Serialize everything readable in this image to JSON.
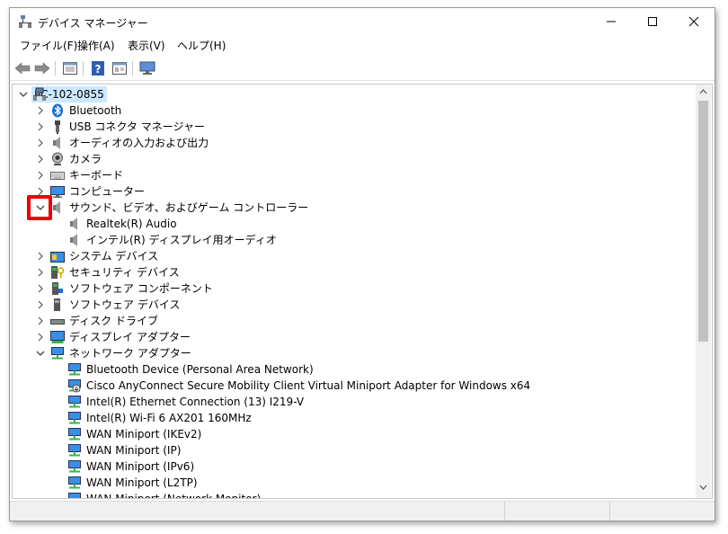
{
  "window": {
    "title": "デバイス マネージャー"
  },
  "menu": {
    "items": [
      "ファイル(F)",
      "操作(A)",
      "表示(V)",
      "ヘルプ(H)"
    ]
  },
  "toolbar": {
    "buttons": [
      "back-arrow-icon",
      "forward-arrow-icon",
      "properties-icon",
      "help-icon",
      "view-icon",
      "monitor-scan-icon"
    ]
  },
  "tree": {
    "root": "PC-102-0855",
    "nodes": [
      {
        "label": "Bluetooth",
        "icon": "bluetooth-icon",
        "state": "collapsed"
      },
      {
        "label": "USB コネクタ マネージャー",
        "icon": "usb-connector-icon",
        "state": "collapsed"
      },
      {
        "label": "オーディオの入力および出力",
        "icon": "speaker-icon",
        "state": "collapsed"
      },
      {
        "label": "カメラ",
        "icon": "camera-icon",
        "state": "collapsed"
      },
      {
        "label": "キーボード",
        "icon": "keyboard-icon",
        "state": "collapsed"
      },
      {
        "label": "コンピューター",
        "icon": "computer-icon",
        "state": "collapsed"
      },
      {
        "label": "サウンド、ビデオ、およびゲーム コントローラー",
        "icon": "speaker-icon",
        "state": "expanded",
        "children": [
          "Realtek(R) Audio",
          "インテル(R) ディスプレイ用オーディオ"
        ]
      },
      {
        "label": "システム デバイス",
        "icon": "system-folder-icon",
        "state": "collapsed"
      },
      {
        "label": "セキュリティ デバイス",
        "icon": "security-device-icon",
        "state": "collapsed"
      },
      {
        "label": "ソフトウェア コンポーネント",
        "icon": "software-component-icon",
        "state": "collapsed"
      },
      {
        "label": "ソフトウェア デバイス",
        "icon": "software-device-icon",
        "state": "collapsed"
      },
      {
        "label": "ディスク ドライブ",
        "icon": "disk-drive-icon",
        "state": "collapsed"
      },
      {
        "label": "ディスプレイ アダプター",
        "icon": "display-adapter-icon",
        "state": "collapsed"
      },
      {
        "label": "ネットワーク アダプター",
        "icon": "network-adapter-icon",
        "state": "expanded",
        "children": [
          "Bluetooth Device (Personal Area Network)",
          "Cisco AnyConnect Secure Mobility Client Virtual Miniport Adapter for Windows x64",
          "Intel(R) Ethernet Connection (13) I219-V",
          "Intel(R) Wi-Fi 6 AX201 160MHz",
          "WAN Miniport (IKEv2)",
          "WAN Miniport (IP)",
          "WAN Miniport (IPv6)",
          "WAN Miniport (L2TP)",
          "WAN Miniport (Network Monitor)"
        ]
      }
    ]
  },
  "colors": {
    "selection": "#cce8ff",
    "highlight": "#ee0000",
    "scroll_thumb": "#c1c1c1"
  }
}
